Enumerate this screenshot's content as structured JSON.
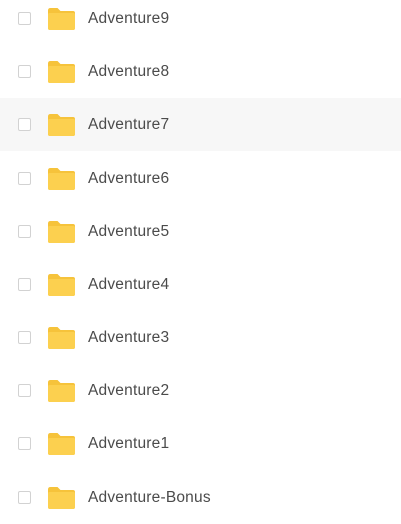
{
  "colors": {
    "folder": "#fcd04f",
    "folder_tab": "#f6c33b",
    "text": "#4b4b4b",
    "hover_row": "#f7f7f7",
    "checkbox_border": "#d2d2d2"
  },
  "folders": [
    {
      "name": "Adventure9",
      "icon": "folder-icon",
      "checked": false,
      "highlighted": false
    },
    {
      "name": "Adventure8",
      "icon": "folder-icon",
      "checked": false,
      "highlighted": false
    },
    {
      "name": "Adventure7",
      "icon": "folder-icon",
      "checked": false,
      "highlighted": true
    },
    {
      "name": "Adventure6",
      "icon": "folder-icon",
      "checked": false,
      "highlighted": false
    },
    {
      "name": "Adventure5",
      "icon": "folder-icon",
      "checked": false,
      "highlighted": false
    },
    {
      "name": "Adventure4",
      "icon": "folder-icon",
      "checked": false,
      "highlighted": false
    },
    {
      "name": "Adventure3",
      "icon": "folder-icon",
      "checked": false,
      "highlighted": false
    },
    {
      "name": "Adventure2",
      "icon": "folder-icon",
      "checked": false,
      "highlighted": false
    },
    {
      "name": "Adventure1",
      "icon": "folder-icon",
      "checked": false,
      "highlighted": false
    },
    {
      "name": "Adventure-Bonus",
      "icon": "folder-icon",
      "checked": false,
      "highlighted": false
    }
  ]
}
